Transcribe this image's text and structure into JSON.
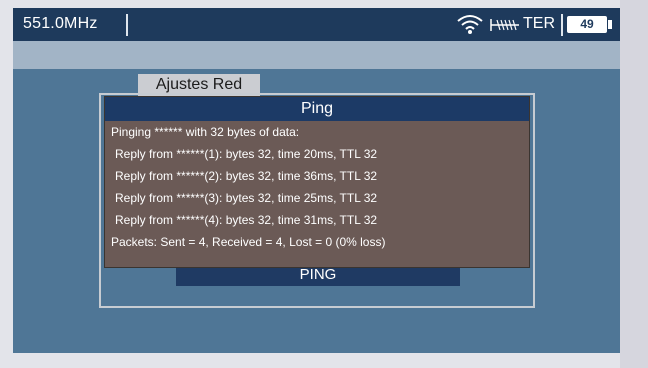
{
  "status_bar": {
    "frequency": "551.0MHz",
    "mode": "TER",
    "battery": "49",
    "icons": [
      "wifi-icon",
      "antenna-signal-icon",
      "battery-icon"
    ]
  },
  "panel": {
    "tab_label": "Ajustes Red",
    "ping_button_label": "PING"
  },
  "dialog": {
    "title": "Ping",
    "lines": [
      "Pinging ****** with 32 bytes of data:",
      "Reply from ******(1): bytes 32, time 20ms, TTL 32",
      "Reply from ******(2): bytes 32, time 36ms, TTL 32",
      "Reply from ******(3): bytes 32, time 25ms, TTL 32",
      "Reply from ******(4): bytes 32, time 31ms, TTL 32",
      "Packets: Sent = 4, Received = 4, Lost = 0 (0% loss)"
    ]
  },
  "colors": {
    "screen_bg": "#4f7696",
    "topbar_bg": "#1e3a5c",
    "dialog_bg": "#6b5a56",
    "dialog_title_bg": "#1c3a66",
    "ping_bar_bg": "#1f3a63"
  }
}
